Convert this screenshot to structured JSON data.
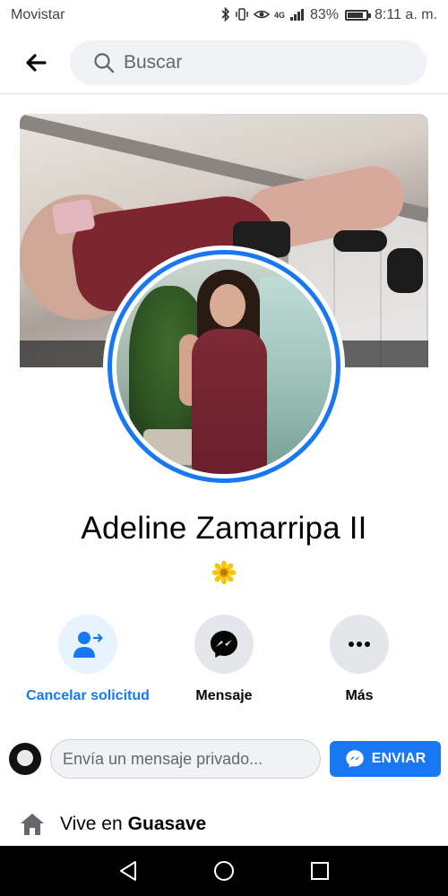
{
  "status_bar": {
    "carrier": "Movistar",
    "signal": "4G",
    "battery_percent": "83%",
    "battery_level": 0.83,
    "time": "8:11 a. m."
  },
  "header": {
    "search_placeholder": "Buscar",
    "icons": [
      "back-arrow-icon",
      "search-icon"
    ]
  },
  "profile": {
    "name": "Adeline Zamarripa II",
    "bio_emoji": "sunflower"
  },
  "actions": [
    {
      "label": "Cancelar solicitud",
      "icon": "cancel-friend-request-icon",
      "primary": true
    },
    {
      "label": "Mensaje",
      "icon": "messenger-icon",
      "primary": false
    },
    {
      "label": "Más",
      "icon": "more-icon",
      "primary": false
    }
  ],
  "message": {
    "placeholder": "Envía un mensaje privado...",
    "send_label": "ENVIAR"
  },
  "intro": {
    "lives_prefix": "Vive en",
    "lives_city": "Guasave"
  },
  "colors": {
    "accent": "#1877f2",
    "action_bg": "#e4e6eb",
    "primary_action_bg": "#e7f3ff"
  }
}
